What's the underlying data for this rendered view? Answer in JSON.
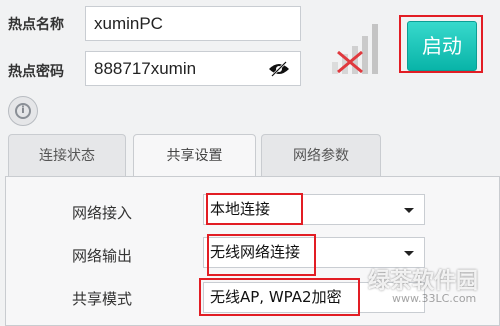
{
  "hotspot": {
    "name_label": "热点名称",
    "name_value": "xuminPC",
    "password_label": "热点密码",
    "password_value": "888717xumin",
    "start_label": "启动"
  },
  "tabs": [
    {
      "label": "连接状态"
    },
    {
      "label": "共享设置"
    },
    {
      "label": "网络参数"
    }
  ],
  "share_settings": {
    "rows": [
      {
        "label": "网络接入",
        "value": "本地连接"
      },
      {
        "label": "网络输出",
        "value": "无线网络连接"
      },
      {
        "label": "共享模式",
        "value": "无线AP, WPA2加密"
      }
    ]
  },
  "watermark": {
    "text": "绿茶软件园",
    "url": "www.33LC.com"
  },
  "colors": {
    "start_button": "#1ec5b9",
    "highlight": "#e21d24"
  }
}
